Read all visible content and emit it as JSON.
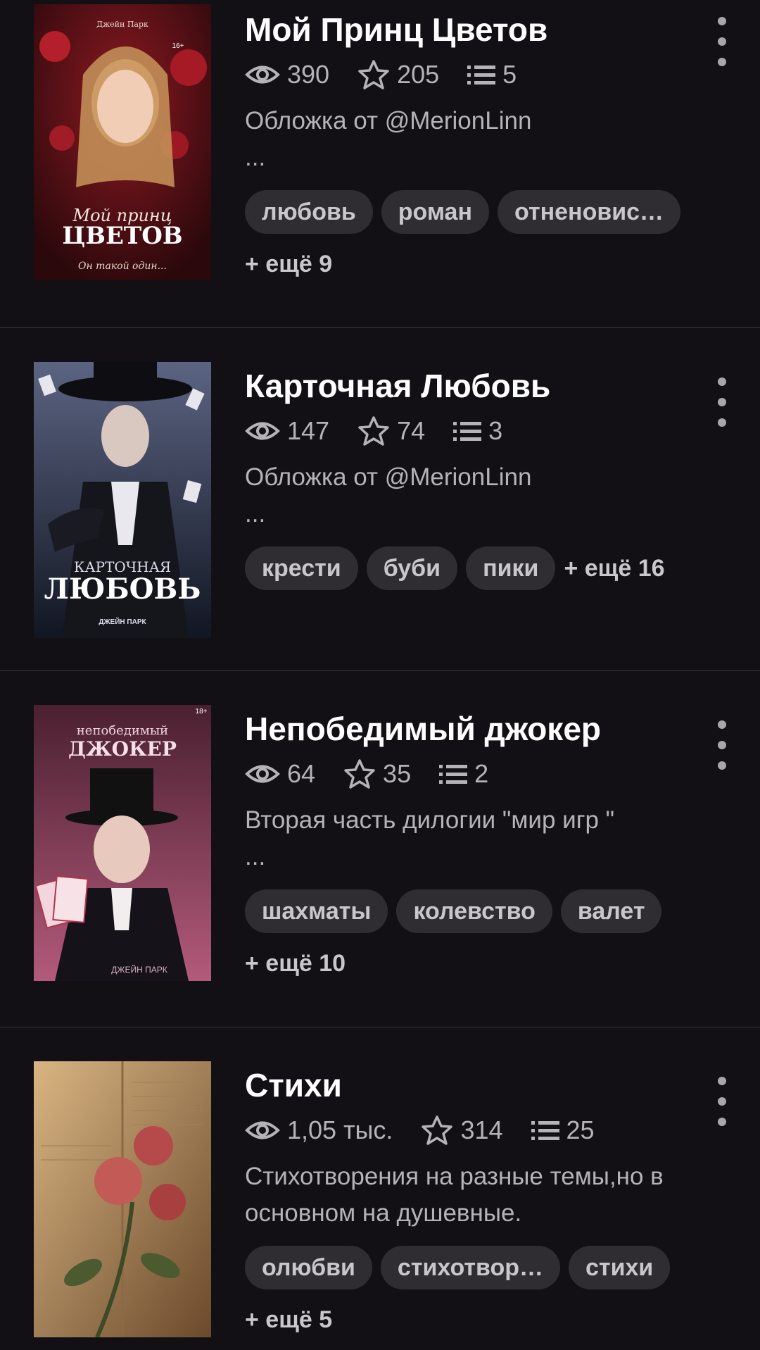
{
  "stories": [
    {
      "title": "Мой Принц Цветов",
      "views": "390",
      "stars": "205",
      "chapters": "5",
      "description": "Обложка от @MerionLinn\n...",
      "tags": [
        "любовь",
        "роман",
        "отненовис…"
      ],
      "more": "+ ещё 9",
      "cover": {
        "author": "Джейн Парк",
        "title_line1": "Мой принц",
        "title_line2": "ЦВЕТОВ",
        "tagline": "Он такой один...",
        "age": "16+",
        "colors": [
          "#3a0c10",
          "#8d1a22"
        ]
      }
    },
    {
      "title": "Карточная Любовь",
      "views": "147",
      "stars": "74",
      "chapters": "3",
      "description": "Обложка от @MerionLinn\n...",
      "tags": [
        "крести",
        "буби",
        "пики"
      ],
      "more": "+ ещё 16",
      "cover": {
        "title_line1": "КАРТОЧНАЯ",
        "title_line2": "ЛЮБОВЬ",
        "author": "ДЖЕЙН ПАРК",
        "colors": [
          "#1d2233",
          "#5b6482"
        ]
      }
    },
    {
      "title": "Непобедимый джокер",
      "views": "64",
      "stars": "35",
      "chapters": "2",
      "description": "Вторая часть дилогии \"мир игр \"\n...",
      "tags": [
        "шахматы",
        "колевство",
        "валет"
      ],
      "more": "+ ещё 10",
      "cover": {
        "title_line1": "непобедимый",
        "title_line2": "ДЖОКЕР",
        "author": "ДЖЕЙН ПАРК",
        "age": "18+",
        "colors": [
          "#2a1520",
          "#b35a7a"
        ]
      }
    },
    {
      "title": "Стихи",
      "views": "1,05 тыс.",
      "stars": "314",
      "chapters": "25",
      "description": "Стихотворения на разные темы,но в основном на душевные.",
      "tags": [
        "олюбви",
        "стихотвор…",
        "стихи"
      ],
      "more": "+ ещё 5",
      "cover": {
        "colors": [
          "#6b4a2c",
          "#d9b582"
        ]
      }
    }
  ],
  "icons": {
    "views": "eye-icon",
    "stars": "star-icon",
    "chapters": "list-icon",
    "menu": "more-vertical-icon"
  }
}
